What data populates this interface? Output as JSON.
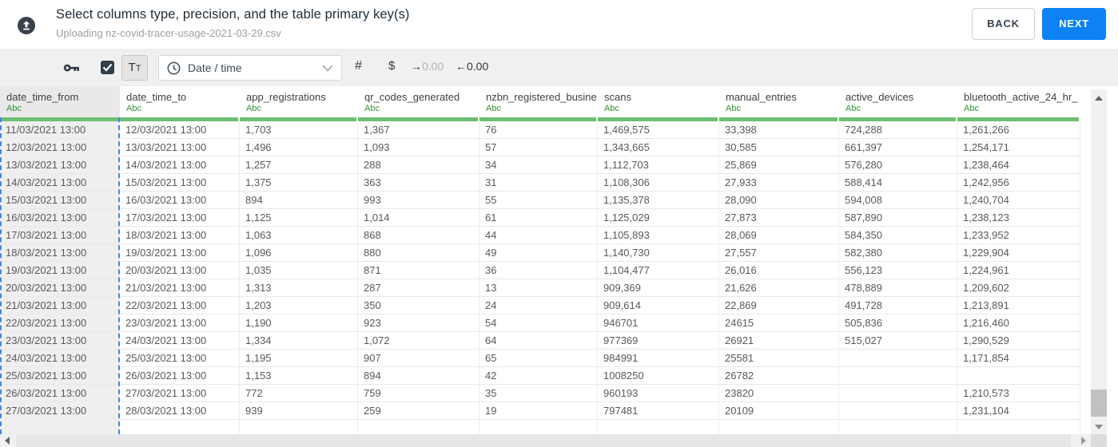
{
  "header": {
    "title": "Select columns type, precision, and the table primary key(s)",
    "subtitle": "Uploading nz-covid-tracer-usage-2021-03-29.csv",
    "back_label": "BACK",
    "next_label": "NEXT",
    "upload_icon": "cloud-upload-icon"
  },
  "toolbar": {
    "key_icon": "key-icon",
    "checkbox_checked": true,
    "text_type_label": "Tt",
    "type_dropdown": {
      "icon": "clock-icon",
      "value": "Date / time",
      "chevron": "chevron-down-icon"
    },
    "number_glyph": "#",
    "currency_glyph": "$",
    "decrease_decimal": {
      "arrow": "→",
      "label": "0.00"
    },
    "increase_decimal": {
      "arrow": "←",
      "label": "0.00"
    }
  },
  "table": {
    "type_label": "Abc",
    "selected_column_index": 0,
    "columns": [
      "date_time_from",
      "date_time_to",
      "app_registrations",
      "qr_codes_generated",
      "nzbn_registered_busine",
      "scans",
      "manual_entries",
      "active_devices",
      "bluetooth_active_24_hr_"
    ],
    "rows": [
      [
        "11/03/2021 13:00",
        "12/03/2021 13:00",
        "1,703",
        "1,367",
        "76",
        "1,469,575",
        "33,398",
        "724,288",
        "1,261,266"
      ],
      [
        "12/03/2021 13:00",
        "13/03/2021 13:00",
        "1,496",
        "1,093",
        "57",
        "1,343,665",
        "30,585",
        "661,397",
        "1,254,171"
      ],
      [
        "13/03/2021 13:00",
        "14/03/2021 13:00",
        "1,257",
        "288",
        "34",
        "1,112,703",
        "25,869",
        "576,280",
        "1,238,464"
      ],
      [
        "14/03/2021 13:00",
        "15/03/2021 13:00",
        "1,375",
        "363",
        "31",
        "1,108,306",
        "27,933",
        "588,414",
        "1,242,956"
      ],
      [
        "15/03/2021 13:00",
        "16/03/2021 13:00",
        "894",
        "993",
        "55",
        "1,135,378",
        "28,090",
        "594,008",
        "1,240,704"
      ],
      [
        "16/03/2021 13:00",
        "17/03/2021 13:00",
        "1,125",
        "1,014",
        "61",
        "1,125,029",
        "27,873",
        "587,890",
        "1,238,123"
      ],
      [
        "17/03/2021 13:00",
        "18/03/2021 13:00",
        "1,063",
        "868",
        "44",
        "1,105,893",
        "28,069",
        "584,350",
        "1,233,952"
      ],
      [
        "18/03/2021 13:00",
        "19/03/2021 13:00",
        "1,096",
        "880",
        "49",
        "1,140,730",
        "27,557",
        "582,380",
        "1,229,904"
      ],
      [
        "19/03/2021 13:00",
        "20/03/2021 13:00",
        "1,035",
        "871",
        "36",
        "1,104,477",
        "26,016",
        "556,123",
        "1,224,961"
      ],
      [
        "20/03/2021 13:00",
        "21/03/2021 13:00",
        "1,313",
        "287",
        "13",
        "909,369",
        "21,626",
        "478,889",
        "1,209,602"
      ],
      [
        "21/03/2021 13:00",
        "22/03/2021 13:00",
        "1,203",
        "350",
        "24",
        "909,614",
        "22,869",
        "491,728",
        "1,213,891"
      ],
      [
        "22/03/2021 13:00",
        "23/03/2021 13:00",
        "1,190",
        "923",
        "54",
        "946701",
        "24615",
        "505,836",
        "1,216,460"
      ],
      [
        "23/03/2021 13:00",
        "24/03/2021 13:00",
        "1,334",
        "1,072",
        "64",
        "977369",
        "26921",
        "515,027",
        "1,290,529"
      ],
      [
        "24/03/2021 13:00",
        "25/03/2021 13:00",
        "1,195",
        "907",
        "65",
        "984991",
        "25581",
        "",
        "1,171,854"
      ],
      [
        "25/03/2021 13:00",
        "26/03/2021 13:00",
        "1,153",
        "894",
        "42",
        "1008250",
        "26782",
        "",
        ""
      ],
      [
        "26/03/2021 13:00",
        "27/03/2021 13:00",
        "772",
        "759",
        "35",
        "960193",
        "23820",
        "",
        "1,210,573"
      ],
      [
        "27/03/2021 13:00",
        "28/03/2021 13:00",
        "939",
        "259",
        "19",
        "797481",
        "20109",
        "",
        "1,231,104"
      ]
    ]
  },
  "colors": {
    "accent_blue": "#0d82f4",
    "selection_dash_blue": "#4285f4",
    "type_green": "#2f9630",
    "underline_green": "#6fbf73",
    "toolbar_bg": "#f1f0f0"
  }
}
